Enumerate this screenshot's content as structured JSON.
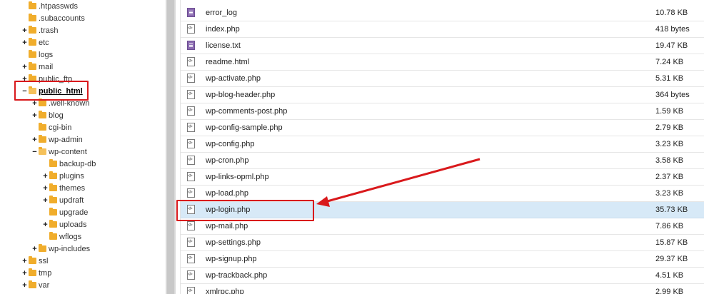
{
  "tree": [
    {
      "label": ".htpasswds",
      "expander": "",
      "indent": 0,
      "open": false,
      "bold": false
    },
    {
      "label": ".subaccounts",
      "expander": "",
      "indent": 0,
      "open": false,
      "bold": false
    },
    {
      "label": ".trash",
      "expander": "+",
      "indent": 0,
      "open": false,
      "bold": false
    },
    {
      "label": "etc",
      "expander": "+",
      "indent": 0,
      "open": false,
      "bold": false
    },
    {
      "label": "logs",
      "expander": "",
      "indent": 0,
      "open": false,
      "bold": false
    },
    {
      "label": "mail",
      "expander": "+",
      "indent": 0,
      "open": false,
      "bold": false
    },
    {
      "label": "public_ftp",
      "expander": "+",
      "indent": 0,
      "open": false,
      "bold": false
    },
    {
      "label": "public_html",
      "expander": "−",
      "indent": 0,
      "open": true,
      "bold": true
    },
    {
      "label": ".well-known",
      "expander": "+",
      "indent": 1,
      "open": false,
      "bold": false
    },
    {
      "label": "blog",
      "expander": "+",
      "indent": 1,
      "open": false,
      "bold": false
    },
    {
      "label": "cgi-bin",
      "expander": "",
      "indent": 1,
      "open": false,
      "bold": false
    },
    {
      "label": "wp-admin",
      "expander": "+",
      "indent": 1,
      "open": false,
      "bold": false
    },
    {
      "label": "wp-content",
      "expander": "−",
      "indent": 1,
      "open": true,
      "bold": false
    },
    {
      "label": "backup-db",
      "expander": "",
      "indent": 2,
      "open": false,
      "bold": false
    },
    {
      "label": "plugins",
      "expander": "+",
      "indent": 2,
      "open": false,
      "bold": false
    },
    {
      "label": "themes",
      "expander": "+",
      "indent": 2,
      "open": false,
      "bold": false
    },
    {
      "label": "updraft",
      "expander": "+",
      "indent": 2,
      "open": false,
      "bold": false
    },
    {
      "label": "upgrade",
      "expander": "",
      "indent": 2,
      "open": false,
      "bold": false
    },
    {
      "label": "uploads",
      "expander": "+",
      "indent": 2,
      "open": false,
      "bold": false
    },
    {
      "label": "wflogs",
      "expander": "",
      "indent": 2,
      "open": false,
      "bold": false
    },
    {
      "label": "wp-includes",
      "expander": "+",
      "indent": 1,
      "open": false,
      "bold": false
    },
    {
      "label": "ssl",
      "expander": "+",
      "indent": 0,
      "open": false,
      "bold": false
    },
    {
      "label": "tmp",
      "expander": "+",
      "indent": 0,
      "open": false,
      "bold": false
    },
    {
      "label": "var",
      "expander": "+",
      "indent": 0,
      "open": false,
      "bold": false
    }
  ],
  "files": [
    {
      "name": "error_log",
      "size": "10.78 KB",
      "icon": "text-file-icon",
      "selected": false
    },
    {
      "name": "index.php",
      "size": "418 bytes",
      "icon": "php-file-icon",
      "selected": false
    },
    {
      "name": "license.txt",
      "size": "19.47 KB",
      "icon": "text-file-icon",
      "selected": false
    },
    {
      "name": "readme.html",
      "size": "7.24 KB",
      "icon": "php-file-icon",
      "selected": false
    },
    {
      "name": "wp-activate.php",
      "size": "5.31 KB",
      "icon": "php-file-icon",
      "selected": false
    },
    {
      "name": "wp-blog-header.php",
      "size": "364 bytes",
      "icon": "php-file-icon",
      "selected": false
    },
    {
      "name": "wp-comments-post.php",
      "size": "1.59 KB",
      "icon": "php-file-icon",
      "selected": false
    },
    {
      "name": "wp-config-sample.php",
      "size": "2.79 KB",
      "icon": "php-file-icon",
      "selected": false
    },
    {
      "name": "wp-config.php",
      "size": "3.23 KB",
      "icon": "php-file-icon",
      "selected": false
    },
    {
      "name": "wp-cron.php",
      "size": "3.58 KB",
      "icon": "php-file-icon",
      "selected": false
    },
    {
      "name": "wp-links-opml.php",
      "size": "2.37 KB",
      "icon": "php-file-icon",
      "selected": false
    },
    {
      "name": "wp-load.php",
      "size": "3.23 KB",
      "icon": "php-file-icon",
      "selected": false
    },
    {
      "name": "wp-login.php",
      "size": "35.73 KB",
      "icon": "php-file-icon",
      "selected": true
    },
    {
      "name": "wp-mail.php",
      "size": "7.86 KB",
      "icon": "php-file-icon",
      "selected": false
    },
    {
      "name": "wp-settings.php",
      "size": "15.87 KB",
      "icon": "php-file-icon",
      "selected": false
    },
    {
      "name": "wp-signup.php",
      "size": "29.37 KB",
      "icon": "php-file-icon",
      "selected": false
    },
    {
      "name": "wp-trackback.php",
      "size": "4.51 KB",
      "icon": "php-file-icon",
      "selected": false
    },
    {
      "name": "xmlrpc.php",
      "size": "2.99 KB",
      "icon": "php-file-icon",
      "selected": false
    }
  ],
  "colors": {
    "annotation": "#d9191c",
    "folder": "#f0ad2c",
    "selected_row": "#d7e9f7"
  }
}
